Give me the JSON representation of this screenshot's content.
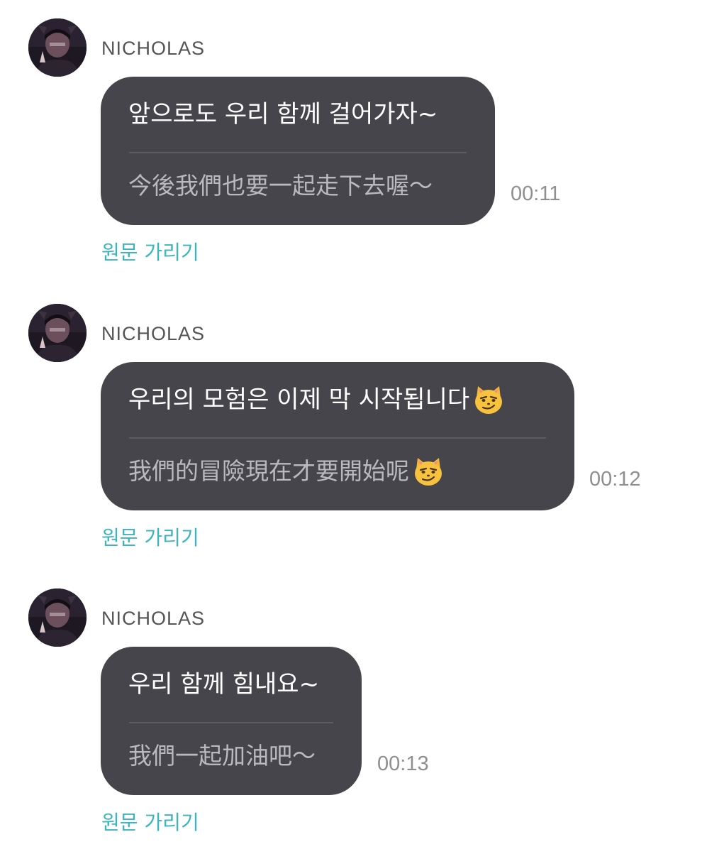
{
  "sender_name": "NICHOLAS",
  "accent_color": "#3bb5bd",
  "bubble_color": "#45454b",
  "avatar_icon": "profile-photo",
  "messages": [
    {
      "original": "앞으로도 우리 함께 걸어가자~",
      "translation": "今後我們也要一起走下去喔～",
      "time": "00:11",
      "toggle_label": "원문 가리기"
    },
    {
      "original": "우리의 모험은 이제 막 시작됩니다",
      "original_emoji": "smirking-cat-emoji",
      "translation": "我們的冒險現在才要開始呢",
      "translation_emoji": "smirking-cat-emoji",
      "time": "00:12",
      "toggle_label": "원문 가리기"
    },
    {
      "original": "우리 함께 힘내요~",
      "translation": "我們一起加油吧～",
      "time": "00:13",
      "toggle_label": "원문 가리기"
    }
  ]
}
